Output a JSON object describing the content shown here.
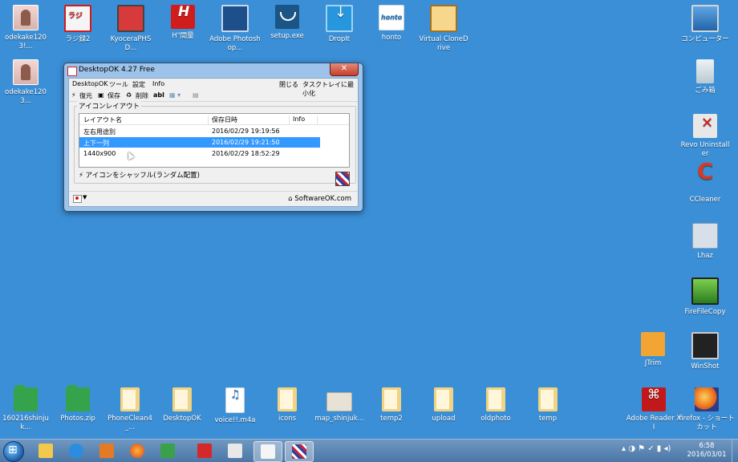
{
  "desktop": {
    "icons": [
      {
        "label": "odekake1203!..."
      },
      {
        "label": "ラジ録2"
      },
      {
        "label": "KyoceraPHSD..."
      },
      {
        "label": "H\"間量"
      },
      {
        "label": "Adobe Photoshop..."
      },
      {
        "label": "setup.exe"
      },
      {
        "label": "DropIt"
      },
      {
        "label": "honto"
      },
      {
        "label": "Virtual CloneDrive"
      },
      {
        "label": "コンピューター"
      },
      {
        "label": "odekake1203..."
      },
      {
        "label": "ごみ箱"
      },
      {
        "label": "Revo Uninstaller"
      },
      {
        "label": "CCleaner"
      },
      {
        "label": "Lhaz"
      },
      {
        "label": "FireFileCopy"
      },
      {
        "label": "JTrim"
      },
      {
        "label": "WinShot"
      },
      {
        "label": "160216shinjuk..."
      },
      {
        "label": "Photos.zip"
      },
      {
        "label": "PhoneClean4_..."
      },
      {
        "label": "DesktopOK"
      },
      {
        "label": "voice!!.m4a"
      },
      {
        "label": "icons"
      },
      {
        "label": "map_shinjuk..."
      },
      {
        "label": "temp2"
      },
      {
        "label": "upload"
      },
      {
        "label": "oldphoto"
      },
      {
        "label": "temp"
      },
      {
        "label": "Adobe Reader XI"
      },
      {
        "label": "firefox - ショートカット"
      }
    ]
  },
  "window": {
    "title": "DesktopOK 4.27 Free",
    "close_glyph": "✕",
    "menu": {
      "desktopok": "DesktopOK",
      "tools": "ツール",
      "settings": "設定",
      "info": "Info",
      "close": "閉じる",
      "minimize_tray": "タスクトレイに最小化"
    },
    "toolbar": {
      "restore": "復元",
      "save": "保存",
      "delete": "削除",
      "abl": "abl"
    },
    "group_label": "アイコンレイアウト",
    "columns": {
      "name": "レイアウト名",
      "date": "保存日時",
      "info": "Info"
    },
    "rows": [
      {
        "name": "左右用途別",
        "date": "2016/02/29 19:19:56",
        "selected": false
      },
      {
        "name": "上下一列",
        "date": "2016/02/29 19:21:50",
        "selected": true
      },
      {
        "name": "1440x900",
        "date": "2016/02/29 18:52:29",
        "selected": false
      }
    ],
    "shuffle_label": "アイコンをシャッフル(ランダム配置)",
    "status_link": "SoftwareOK.com"
  },
  "taskbar": {
    "time": "6:58",
    "date": "2016/03/01"
  }
}
